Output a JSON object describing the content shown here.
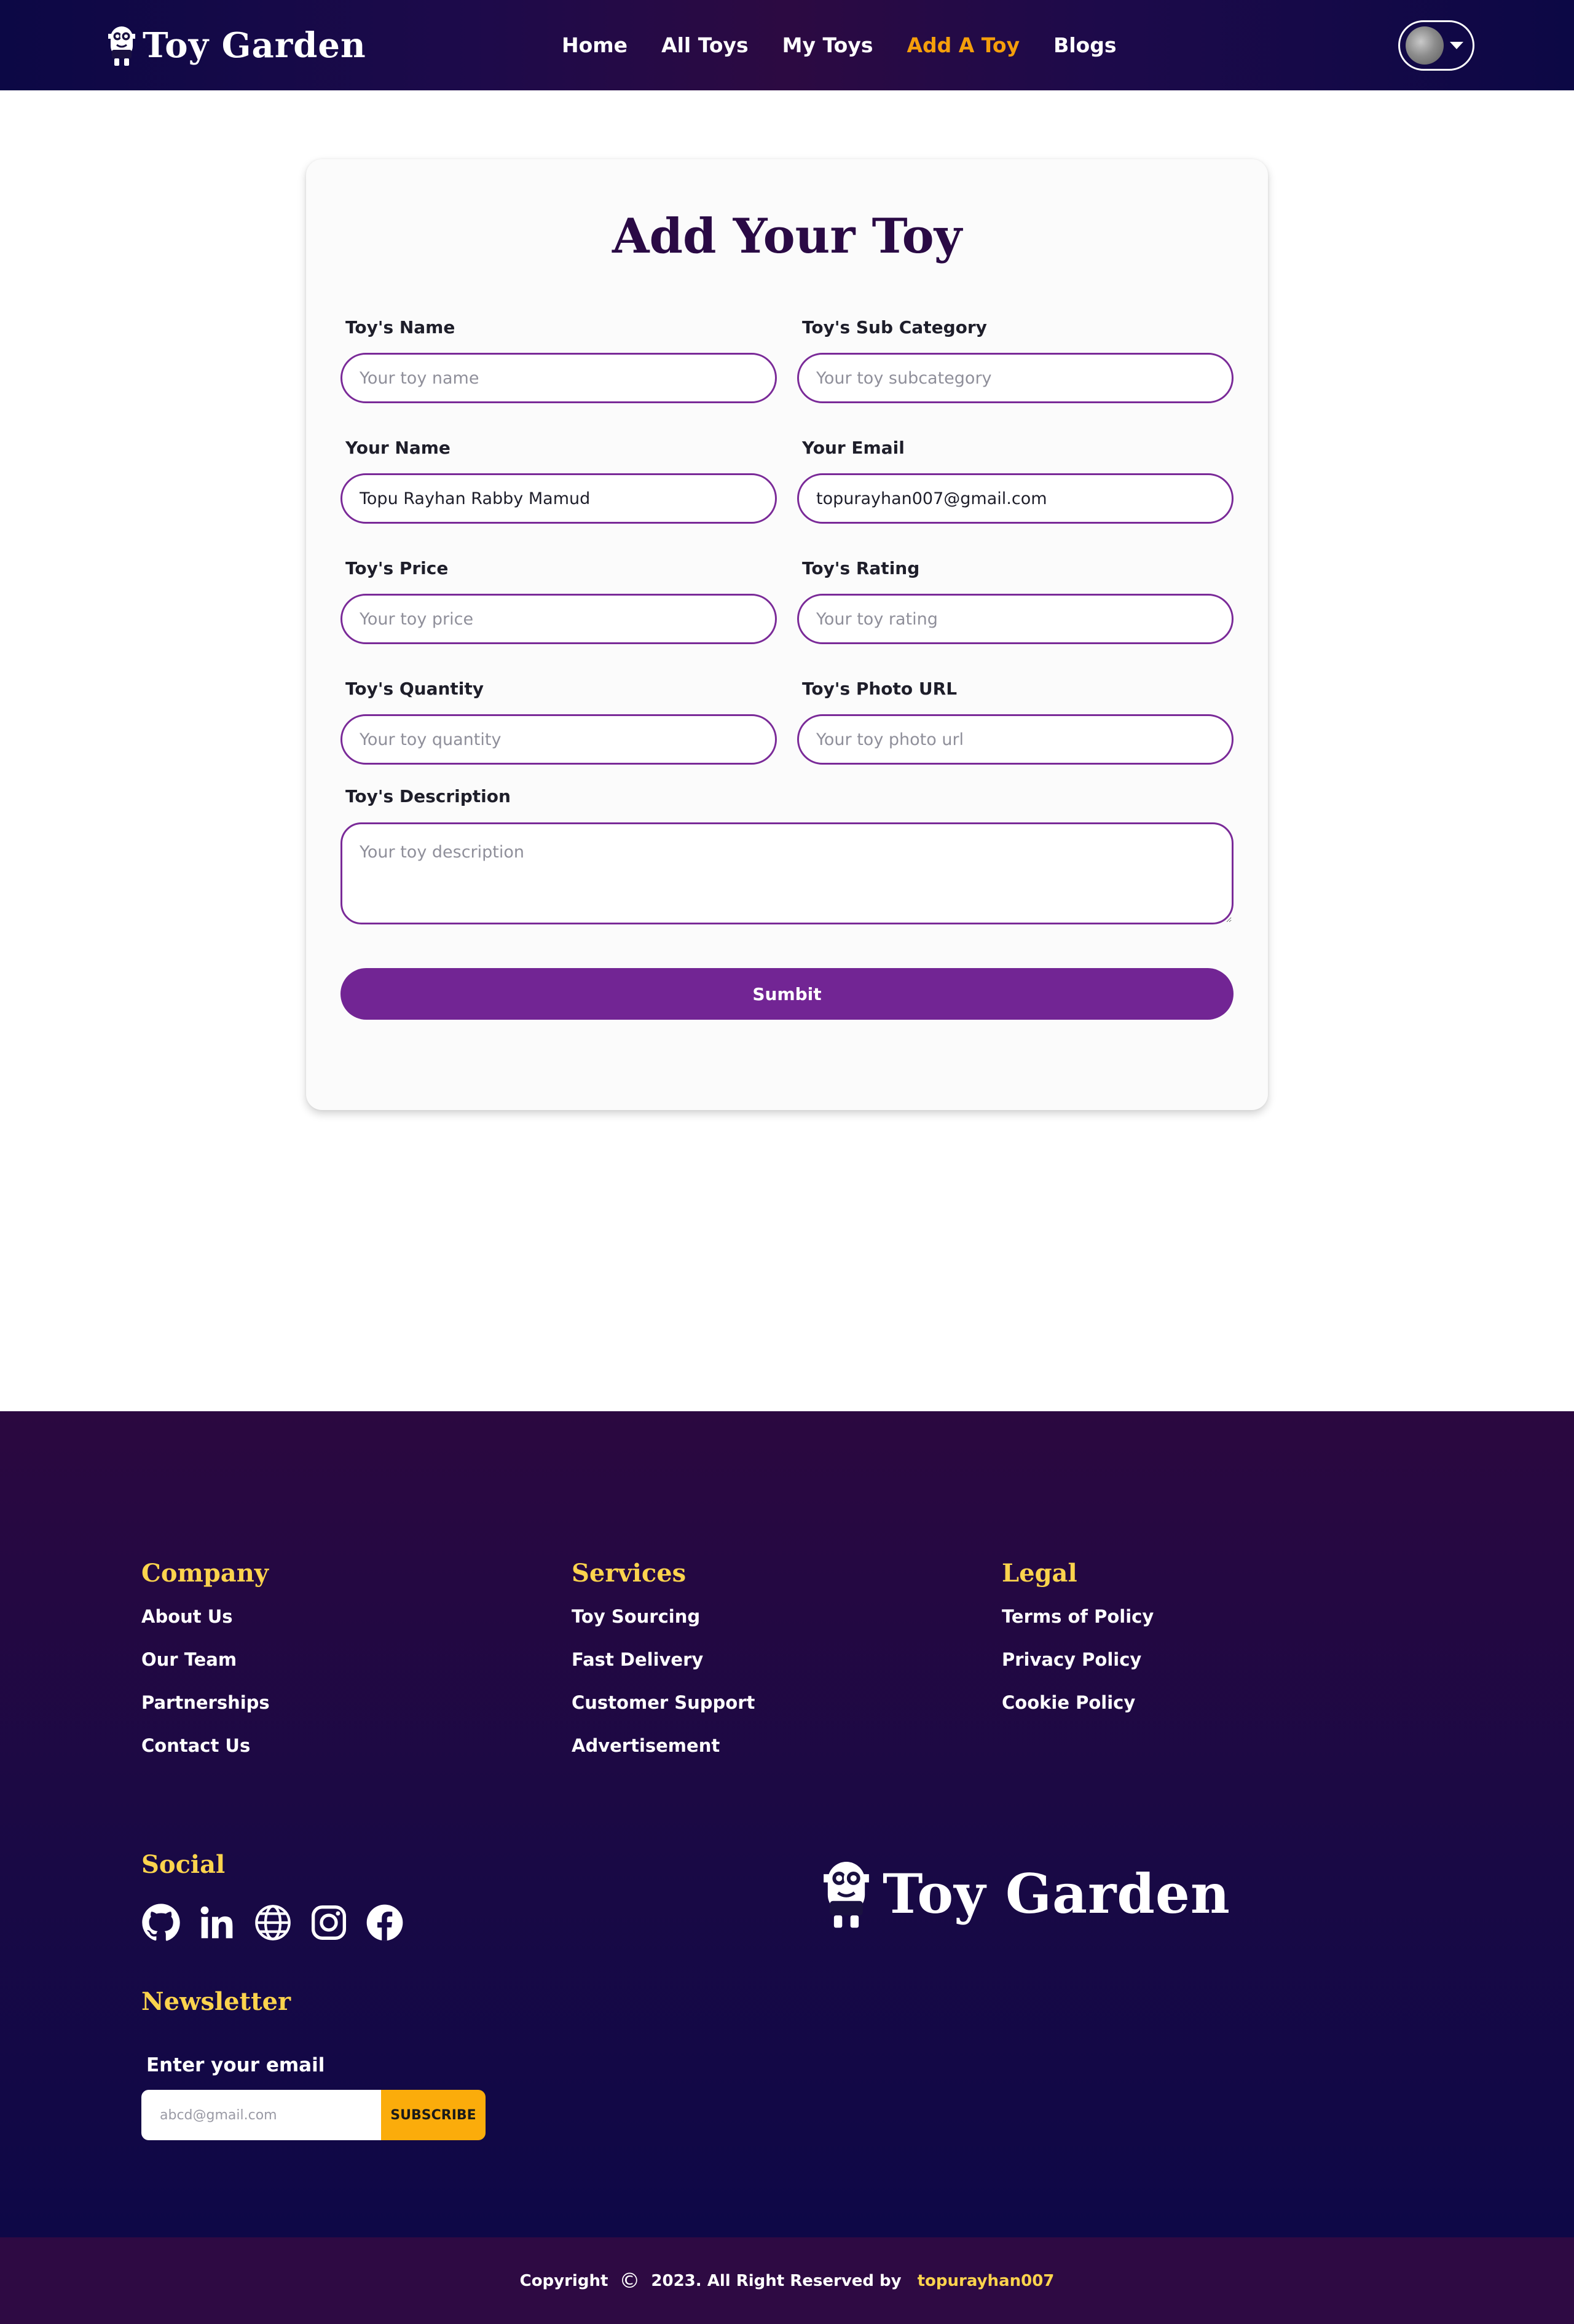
{
  "colors": {
    "nav_gradient": [
      "#0c0845",
      "#2c0a42"
    ],
    "accent_orange": "#f59e0b",
    "primary_purple": "#722594",
    "input_border": "#7a2a98",
    "title_color": "#2a0a45",
    "footer_heading": "#fcd34d",
    "subscribe_button": "#fbac0b",
    "bottom_bar": "#2e0a43"
  },
  "nav": {
    "brand": "Toy Garden",
    "brand_icon": "minion-logo-icon",
    "links": [
      {
        "label": "Home",
        "active": false
      },
      {
        "label": "All Toys",
        "active": false
      },
      {
        "label": "My Toys",
        "active": false
      },
      {
        "label": "Add A Toy",
        "active": true
      },
      {
        "label": "Blogs",
        "active": false
      }
    ],
    "user_icon": "avatar",
    "dropdown_icon": "caret-down-icon"
  },
  "form": {
    "title": "Add Your Toy",
    "fields": {
      "toy_name": {
        "label": "Toy's Name",
        "placeholder": "Your toy name",
        "value": ""
      },
      "sub_category": {
        "label": "Toy's Sub Category",
        "placeholder": "Your toy subcategory",
        "value": ""
      },
      "seller_name": {
        "label": "Your Name",
        "placeholder": "",
        "value": "Topu Rayhan Rabby Mamud"
      },
      "seller_email": {
        "label": "Your Email",
        "placeholder": "",
        "value": "topurayhan007@gmail.com"
      },
      "price": {
        "label": "Toy's Price",
        "placeholder": "Your toy price",
        "value": ""
      },
      "rating": {
        "label": "Toy's Rating",
        "placeholder": "Your toy rating",
        "value": ""
      },
      "quantity": {
        "label": "Toy's Quantity",
        "placeholder": "Your toy quantity",
        "value": ""
      },
      "photo_url": {
        "label": "Toy's Photo URL",
        "placeholder": "Your toy photo url",
        "value": ""
      },
      "description": {
        "label": "Toy's Description",
        "placeholder": "Your toy description",
        "value": ""
      }
    },
    "submit_label": "Sumbit"
  },
  "footer": {
    "company": {
      "title": "Company",
      "links": [
        "About Us",
        "Our Team",
        "Partnerships",
        "Contact Us"
      ]
    },
    "services": {
      "title": "Services",
      "links": [
        "Toy Sourcing",
        "Fast Delivery",
        "Customer Support",
        "Advertisement"
      ]
    },
    "legal": {
      "title": "Legal",
      "links": [
        "Terms of Policy",
        "Privacy Policy",
        "Cookie Policy"
      ]
    },
    "social": {
      "title": "Social",
      "icons": [
        "github-icon",
        "linkedin-icon",
        "globe-icon",
        "instagram-icon",
        "facebook-icon"
      ]
    },
    "newsletter": {
      "title": "Newsletter",
      "label": "Enter your email",
      "placeholder": "abcd@gmail.com",
      "button": "SUBSCRIBE"
    },
    "brand": "Toy Garden"
  },
  "bottom_bar": {
    "copyright_label": "Copyright",
    "copyright_symbol": "©",
    "text": "2023. All Right Reserved by",
    "author": "topurayhan007"
  }
}
